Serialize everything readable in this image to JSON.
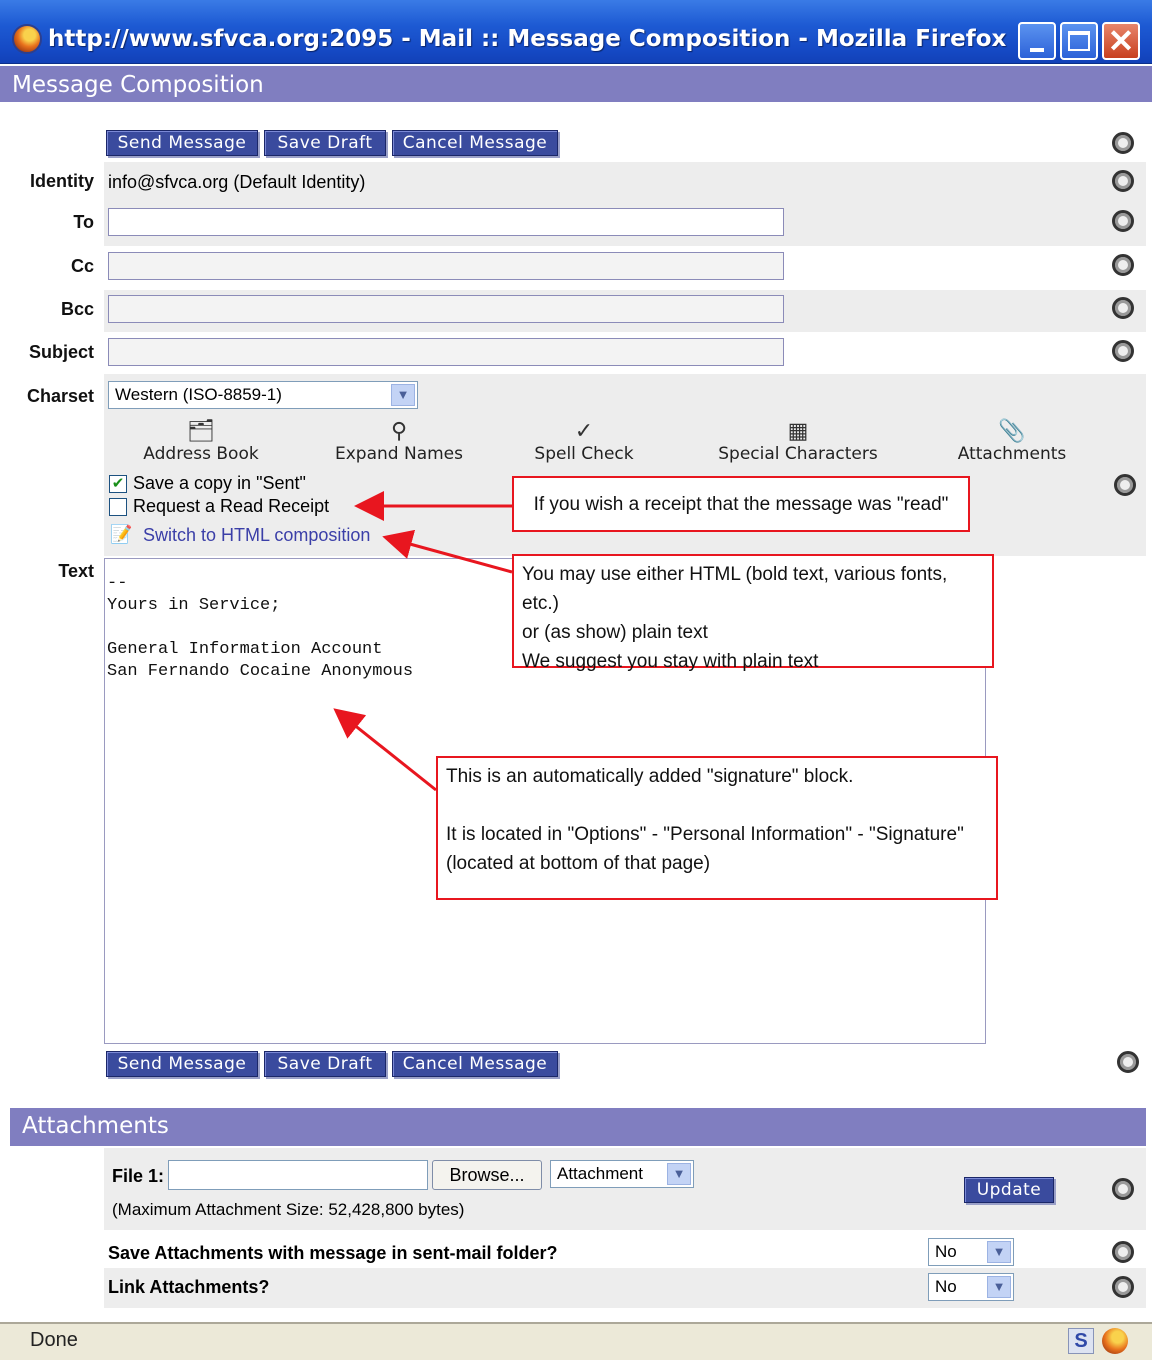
{
  "window": {
    "title": "http://www.sfvca.org:2095 - Mail :: Message Composition - Mozilla Firefox"
  },
  "header": {
    "title": "Message Composition"
  },
  "buttons": {
    "send": "Send Message",
    "save_draft": "Save Draft",
    "cancel": "Cancel Message",
    "update": "Update",
    "browse": "Browse..."
  },
  "fields": {
    "identity_label": "Identity",
    "identity_value": "info@sfvca.org (Default Identity)",
    "to_label": "To",
    "cc_label": "Cc",
    "bcc_label": "Bcc",
    "subject_label": "Subject",
    "charset_label": "Charset",
    "charset_value": "Western (ISO-8859-1)",
    "text_label": "Text"
  },
  "tools": [
    {
      "label": "Address Book",
      "icon": "address-book-icon"
    },
    {
      "label": "Expand Names",
      "icon": "expand-names-icon"
    },
    {
      "label": "Spell Check",
      "icon": "spell-check-icon"
    },
    {
      "label": "Special Characters",
      "icon": "special-characters-icon"
    },
    {
      "label": "Attachments",
      "icon": "paperclip-icon"
    }
  ],
  "options": {
    "save_copy": "Save a copy in \"Sent\"",
    "save_copy_checked": true,
    "read_receipt": "Request a Read Receipt",
    "read_receipt_checked": false,
    "html_switch": "Switch to HTML composition"
  },
  "body_text": "--\nYours in Service;\n\nGeneral Information Account\nSan Fernando Cocaine Anonymous",
  "callouts": {
    "receipt": "If you wish a receipt that the message was \"read\"",
    "html_1": "You may use either HTML (bold text, various fonts, etc.)",
    "html_2": "or (as show) plain text",
    "html_3": "We suggest you stay with plain text",
    "sig_1": "This is an automatically added \"signature\" block.",
    "sig_2": "It is located in \"Options\" - \"Personal Information\" - \"Signature\"",
    "sig_3": "(located at bottom of that page)"
  },
  "attachments": {
    "title": "Attachments",
    "file_label": "File 1:",
    "type_value": "Attachment",
    "max_size": "(Maximum Attachment Size: 52,428,800 bytes)",
    "save_question": "Save Attachments with message in sent-mail folder?",
    "save_value": "No",
    "link_question": "Link Attachments?",
    "link_value": "No"
  },
  "status": {
    "text": "Done",
    "s_badge": "S"
  },
  "colors": {
    "header": "#807ec0",
    "button": "#3a4b9e",
    "callout_border": "#e8161f",
    "titlebar": "#1d5ad3"
  }
}
